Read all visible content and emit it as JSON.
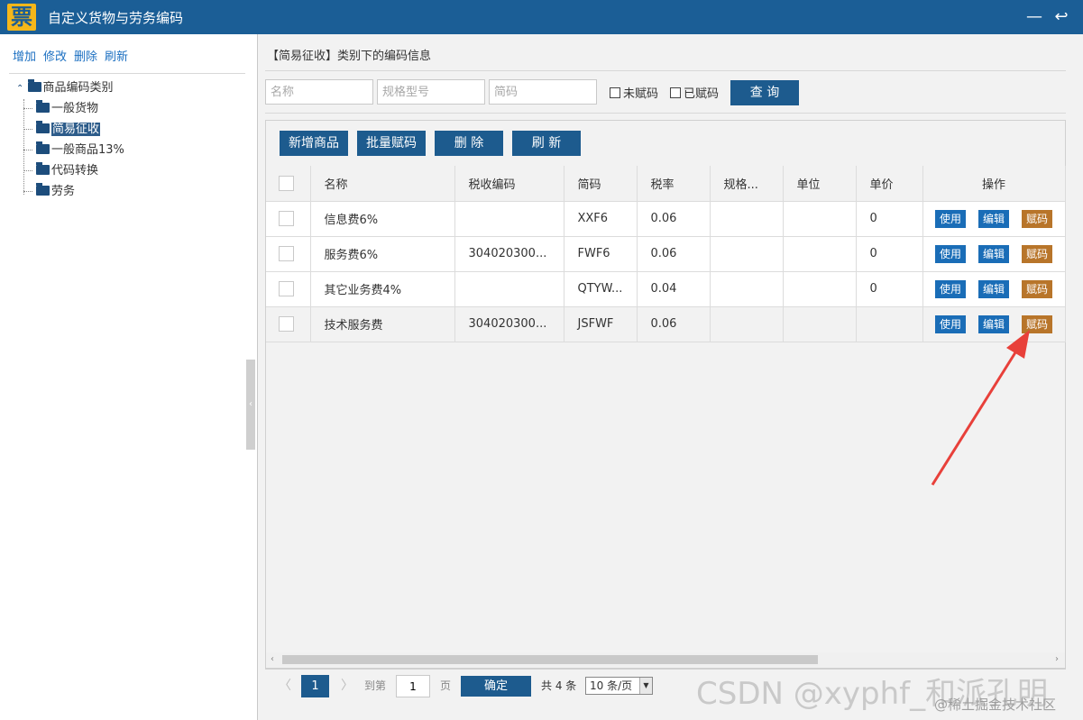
{
  "window": {
    "logo_char": "票",
    "title": "自定义货物与劳务编码",
    "minimize_glyph": "—",
    "back_glyph": "↩"
  },
  "left_toolbar": {
    "add": "增加",
    "edit": "修改",
    "delete": "删除",
    "refresh": "刷新"
  },
  "tree": {
    "root": "商品编码类别",
    "children": [
      "一般货物",
      "简易征收",
      "一般商品13%",
      "代码转换",
      "劳务"
    ],
    "selected": "简易征收"
  },
  "right": {
    "section_title": "【简易征收】类别下的编码信息",
    "search": {
      "name_placeholder": "名称",
      "spec_placeholder": "规格型号",
      "code_placeholder": "简码",
      "unassigned_label": "未赋码",
      "assigned_label": "已赋码",
      "query_button": "查 询"
    },
    "actions": {
      "add_product": "新增商品",
      "batch_assign": "批量赋码",
      "delete": "删 除",
      "refresh": "刷 新"
    }
  },
  "table": {
    "columns": [
      "名称",
      "税收编码",
      "简码",
      "税率",
      "规格...",
      "单位",
      "单价",
      "操作"
    ],
    "rows": [
      {
        "name": "信息费6%",
        "tax_code": "",
        "short_code": "XXF6",
        "rate": "0.06",
        "spec": "",
        "unit": "",
        "price": "0"
      },
      {
        "name": "服务费6%",
        "tax_code": "304020300...",
        "short_code": "FWF6",
        "rate": "0.06",
        "spec": "",
        "unit": "",
        "price": "0"
      },
      {
        "name": "其它业务费4%",
        "tax_code": "",
        "short_code": "QTYW...",
        "rate": "0.04",
        "spec": "",
        "unit": "",
        "price": "0"
      },
      {
        "name": "技术服务费",
        "tax_code": "304020300...",
        "short_code": "JSFWF",
        "rate": "0.06",
        "spec": "",
        "unit": "",
        "price": ""
      }
    ],
    "op_use": "使用",
    "op_edit": "编辑",
    "op_assign": "赋码"
  },
  "pager": {
    "prev": "〈",
    "current_page": "1",
    "next": "〉",
    "goto_label": "到第",
    "goto_value": "1",
    "page_suffix": "页",
    "confirm": "确定",
    "total": "共 4 条",
    "page_size": "10 条/页"
  },
  "watermark": {
    "main": "CSDN @xyphf_和派孔明",
    "sub": "@稀土掘金技术社区"
  },
  "colors": {
    "titlebar": "#1b5e96",
    "primary_button": "#1d5b8e",
    "op_blue": "#1a6db7",
    "op_brown": "#b8752a",
    "annotation_arrow": "#e8403a"
  }
}
